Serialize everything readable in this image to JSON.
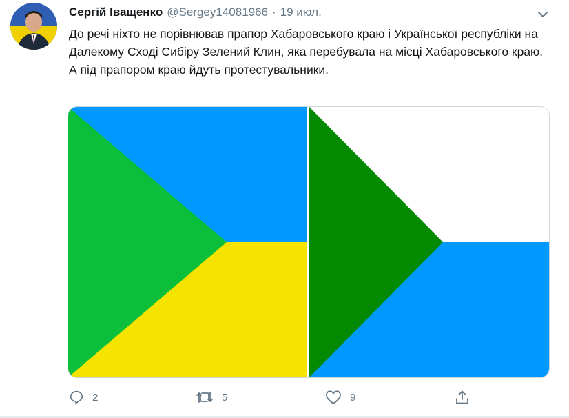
{
  "author": {
    "name": "Сергій Іващенко",
    "handle": "@Sergey14081966",
    "separator": "·",
    "date": "19 июл."
  },
  "tweet": {
    "text": "До речі ніхто не порівнював прапор Хабаровського краю і Української республіки на Далекому Сході Сибіру Зелений Клин, яка перебувала на місці Хабаровського краю. А під прапором краю йдуть протестувальники."
  },
  "media": {
    "left_flag": {
      "colors": {
        "blue": "#0099ff",
        "yellow": "#f6e400",
        "green": "#0bbf3a"
      }
    },
    "right_flag": {
      "colors": {
        "white": "#ffffff",
        "blue": "#0099ff",
        "green": "#038a00"
      }
    }
  },
  "actions": {
    "reply": {
      "icon": "reply-icon",
      "count": "2"
    },
    "retweet": {
      "icon": "retweet-icon",
      "count": "5"
    },
    "like": {
      "icon": "heart-icon",
      "count": "9"
    },
    "share": {
      "icon": "share-icon"
    }
  },
  "colors": {
    "text": "#14171a",
    "muted": "#657786",
    "border": "#ccd6dd"
  }
}
